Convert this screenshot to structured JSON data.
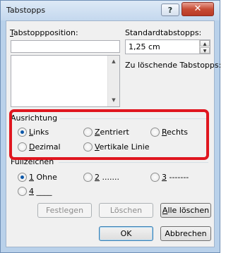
{
  "window": {
    "title": "Tabstopps",
    "help_label": "?",
    "close_label": "✕"
  },
  "tab_position": {
    "label_mnemonic": "T",
    "label_rest": "abstoppposition:",
    "value": ""
  },
  "default_tabs": {
    "label": "Standardtabstopps:",
    "value": "1,25 cm"
  },
  "to_clear": {
    "label": "Zu löschende Tabstopps:"
  },
  "alignment": {
    "title": "Ausrichtung",
    "options": [
      {
        "mnemonic": "L",
        "rest": "inks",
        "checked": true
      },
      {
        "mnemonic": "Z",
        "rest": "entriert",
        "checked": false
      },
      {
        "mnemonic": "R",
        "rest": "echts",
        "checked": false
      },
      {
        "mnemonic": "D",
        "rest": "ezimal",
        "checked": false
      },
      {
        "mnemonic": "V",
        "rest": "ertikale Linie",
        "checked": false
      }
    ]
  },
  "leader": {
    "title": "Füllzeichen",
    "options": [
      {
        "mnemonic": "1",
        "rest": " Ohne",
        "checked": true
      },
      {
        "mnemonic": "2",
        "rest": " .......",
        "checked": false
      },
      {
        "mnemonic": "3",
        "rest": " -------",
        "checked": false
      },
      {
        "mnemonic": "4",
        "rest": " ____",
        "checked": false
      }
    ]
  },
  "buttons": {
    "set": "Festlegen",
    "clear": "Löschen",
    "clear_all_mnemonic": "A",
    "clear_all_rest": "lle löschen",
    "ok": "OK",
    "cancel": "Abbrechen"
  },
  "colors": {
    "highlight": "#e0161f",
    "titlebar": "#c4d8ee",
    "close_button": "#c74c35"
  }
}
